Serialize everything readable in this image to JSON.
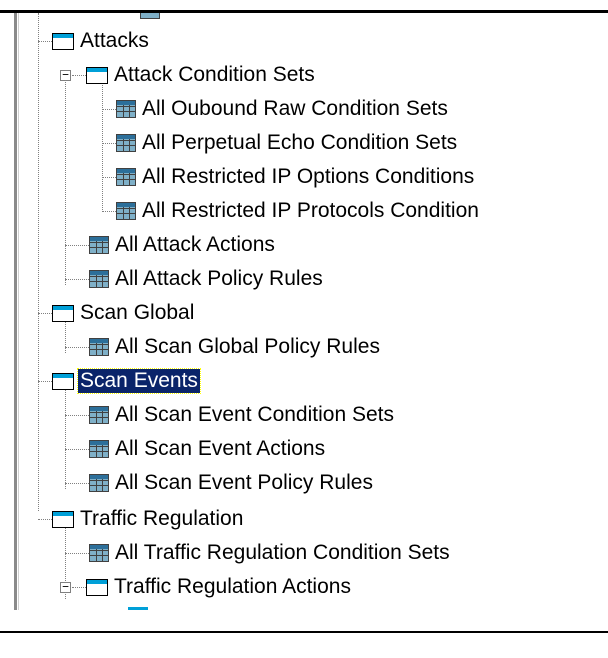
{
  "tree": {
    "items": [
      {
        "label": "Attacks",
        "icon": "folder-icon"
      },
      {
        "label": "Attack Condition Sets",
        "icon": "folder-icon",
        "expanded": true
      },
      {
        "label": "All Oubound Raw Condition Sets",
        "icon": "table-icon"
      },
      {
        "label": "All Perpetual Echo Condition Sets",
        "icon": "table-icon"
      },
      {
        "label": "All Restricted IP Options Conditions",
        "icon": "table-icon"
      },
      {
        "label": "All Restricted IP Protocols Condition",
        "icon": "table-icon"
      },
      {
        "label": "All Attack Actions",
        "icon": "table-icon"
      },
      {
        "label": "All Attack Policy Rules",
        "icon": "table-icon"
      },
      {
        "label": "Scan Global",
        "icon": "folder-icon"
      },
      {
        "label": "All Scan Global Policy Rules",
        "icon": "table-icon"
      },
      {
        "label": "Scan Events",
        "icon": "folder-icon",
        "selected": true
      },
      {
        "label": "All Scan Event Condition Sets",
        "icon": "table-icon"
      },
      {
        "label": "All Scan Event Actions",
        "icon": "table-icon"
      },
      {
        "label": "All Scan Event Policy Rules",
        "icon": "table-icon"
      },
      {
        "label": "Traffic Regulation",
        "icon": "folder-icon"
      },
      {
        "label": "All Traffic Regulation Condition Sets",
        "icon": "table-icon"
      },
      {
        "label": "Traffic Regulation Actions",
        "icon": "folder-icon",
        "expanded": true
      }
    ],
    "expander_symbol": "−"
  },
  "colors": {
    "selection_bg": "#0a246a",
    "selection_outline": "#ffff00",
    "folder_tab": "#00a0d8"
  }
}
